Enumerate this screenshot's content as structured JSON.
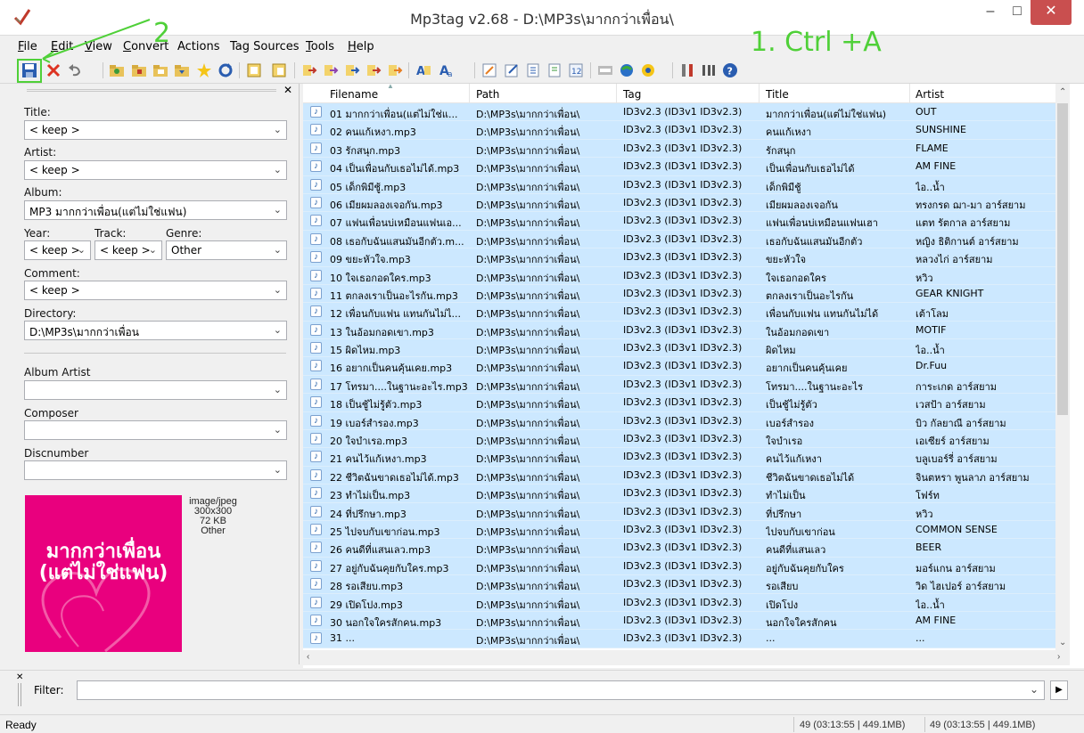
{
  "window": {
    "title": "Mp3tag v2.68  -  D:\\MP3s\\มากกว่าเพื่อน\\",
    "min": "–",
    "max": "□",
    "close": "✕"
  },
  "menu": [
    {
      "label": "File",
      "u": "F",
      "rest": "ile"
    },
    {
      "label": "Edit",
      "u": "E",
      "rest": "dit"
    },
    {
      "label": "View",
      "u": "V",
      "rest": "iew"
    },
    {
      "label": "Convert",
      "u": "C",
      "rest": "onvert"
    },
    {
      "label": "Actions",
      "u": "",
      "rest": "Actions"
    },
    {
      "label": "Tag Sources",
      "u": "",
      "rest": "Tag Sources"
    },
    {
      "label": "Tools",
      "u": "T",
      "rest": "ools"
    },
    {
      "label": "Help",
      "u": "H",
      "rest": "elp"
    }
  ],
  "toolbar_icons": [
    "save-icon",
    "remove-tag-icon",
    "undo-icon",
    "open-folder-icon",
    "add-folder-icon",
    "playlist-folder-icon",
    "folder-icon",
    "favorite-star-icon",
    "refresh-icon",
    "extended-tags-icon",
    "copy-tag-icon",
    "tag-filename-icon",
    "filename-tag-icon",
    "text-file-icon",
    "tag-tag-icon",
    "filename-filename-icon",
    "autonumber-icon",
    "case-convert-icon",
    "format-value-icon",
    "edit-icon",
    "export-icon",
    "playlist-icon",
    "web-source-icon",
    "freedb-icon",
    "tools-icon",
    "options-icon",
    "help-icon"
  ],
  "colors": {
    "row_selected": "#cce8ff",
    "annotation": "#4fd038",
    "cover": "#e9007e",
    "close": "#c94f4f"
  },
  "left_panel": {
    "title_label": "Title:",
    "title_value": "< keep >",
    "artist_label": "Artist:",
    "artist_value": "< keep >",
    "album_label": "Album:",
    "album_value": "MP3 มากกว่าเพื่อน(แต่ไม่ใช่แฟน)",
    "year_label": "Year:",
    "year_value": "< keep >",
    "track_label": "Track:",
    "track_value": "< keep >",
    "genre_label": "Genre:",
    "genre_value": "Other",
    "comment_label": "Comment:",
    "comment_value": "< keep >",
    "directory_label": "Directory:",
    "directory_value": "D:\\MP3s\\มากกว่าเพื่อน",
    "album_artist_label": "Album Artist",
    "composer_label": "Composer",
    "discnumber_label": "Discnumber",
    "cover_text_line1": "มากกว่าเพื่อน",
    "cover_text_line2": "(แต่ไม่ใช่แฟน)",
    "cover_mime": "image/jpeg",
    "cover_dims": "300x300",
    "cover_size": "72 KB",
    "cover_type": "Other"
  },
  "list": {
    "columns": [
      "Filename",
      "Path",
      "Tag",
      "Title",
      "Artist"
    ],
    "rows": [
      {
        "filename": "01 มากกว่าเพื่อน(แต่ไม่ใช่แ...",
        "path": "D:\\MP3s\\มากกว่าเพื่อน\\",
        "tag": "ID3v2.3 (ID3v1 ID3v2.3)",
        "title": "มากกว่าเพื่อน(แต่ไม่ใช่แฟน)",
        "artist": "OUT"
      },
      {
        "filename": "02 คนแก้เหงา.mp3",
        "path": "D:\\MP3s\\มากกว่าเพื่อน\\",
        "tag": "ID3v2.3 (ID3v1 ID3v2.3)",
        "title": "คนแก้เหงา",
        "artist": "SUNSHINE"
      },
      {
        "filename": "03 รักสนุก.mp3",
        "path": "D:\\MP3s\\มากกว่าเพื่อน\\",
        "tag": "ID3v2.3 (ID3v1 ID3v2.3)",
        "title": "รักสนุก",
        "artist": "FLAME"
      },
      {
        "filename": "04 เป็นเพื่อนกับเธอไม่ได้.mp3",
        "path": "D:\\MP3s\\มากกว่าเพื่อน\\",
        "tag": "ID3v2.3 (ID3v1 ID3v2.3)",
        "title": "เป็นเพื่อนกับเธอไม่ได้",
        "artist": "AM FINE"
      },
      {
        "filename": "05 เด็กพิมีชู้.mp3",
        "path": "D:\\MP3s\\มากกว่าเพื่อน\\",
        "tag": "ID3v2.3 (ID3v1 ID3v2.3)",
        "title": "เด็กพิมีชู้",
        "artist": "ไอ..น้ำ"
      },
      {
        "filename": "06 เมียผมลองเจอกัน.mp3",
        "path": "D:\\MP3s\\มากกว่าเพื่อน\\",
        "tag": "ID3v2.3 (ID3v1 ID3v2.3)",
        "title": "เมียผมลองเจอกัน",
        "artist": "ทรงกรด ฌา-มา อาร์สยาม"
      },
      {
        "filename": "07 แฟนเพื่อนบ่เหมือนแฟนเอ...",
        "path": "D:\\MP3s\\มากกว่าเพื่อน\\",
        "tag": "ID3v2.3 (ID3v1 ID3v2.3)",
        "title": "แฟนเพื่อนบ่เหมือนแฟนเฮา",
        "artist": "แตท รัตกาล อาร์สยาม"
      },
      {
        "filename": "08 เธอกับฉันแสนมันอีกตัว.m...",
        "path": "D:\\MP3s\\มากกว่าเพื่อน\\",
        "tag": "ID3v2.3 (ID3v1 ID3v2.3)",
        "title": "เธอกับฉันแสนมันอีกตัว",
        "artist": "หญิง ธิติกานต์ อาร์สยาม"
      },
      {
        "filename": "09 ขยะหัวใจ.mp3",
        "path": "D:\\MP3s\\มากกว่าเพื่อน\\",
        "tag": "ID3v2.3 (ID3v1 ID3v2.3)",
        "title": "ขยะหัวใจ",
        "artist": "หลวงไก่ อาร์สยาม"
      },
      {
        "filename": "10 ใจเธอกอดใคร.mp3",
        "path": "D:\\MP3s\\มากกว่าเพื่อน\\",
        "tag": "ID3v2.3 (ID3v1 ID3v2.3)",
        "title": "ใจเธอกอดใคร",
        "artist": "หวิว"
      },
      {
        "filename": "11 ตกลงเราเป็นอะไรกัน.mp3",
        "path": "D:\\MP3s\\มากกว่าเพื่อน\\",
        "tag": "ID3v2.3 (ID3v1 ID3v2.3)",
        "title": "ตกลงเราเป็นอะไรกัน",
        "artist": "GEAR KNIGHT"
      },
      {
        "filename": "12 เพื่อนกับแฟน แทนกันไม่ไ...",
        "path": "D:\\MP3s\\มากกว่าเพื่อน\\",
        "tag": "ID3v2.3 (ID3v1 ID3v2.3)",
        "title": "เพื่อนกับแฟน แทนกันไม่ได้",
        "artist": "เต้าโลม"
      },
      {
        "filename": "13 ในอ้อมกอดเขา.mp3",
        "path": "D:\\MP3s\\มากกว่าเพื่อน\\",
        "tag": "ID3v2.3 (ID3v1 ID3v2.3)",
        "title": "ในอ้อมกอดเขา",
        "artist": "MOTIF"
      },
      {
        "filename": "15 ผิดไหม.mp3",
        "path": "D:\\MP3s\\มากกว่าเพื่อน\\",
        "tag": "ID3v2.3 (ID3v1 ID3v2.3)",
        "title": "ผิดไหม",
        "artist": "ไอ..น้ำ"
      },
      {
        "filename": "16 อยากเป็นคนคุ้นเคย.mp3",
        "path": "D:\\MP3s\\มากกว่าเพื่อน\\",
        "tag": "ID3v2.3 (ID3v1 ID3v2.3)",
        "title": "อยากเป็นคนคุ้นเคย",
        "artist": "Dr.Fuu"
      },
      {
        "filename": "17 โทรมา....ในฐานะอะไร.mp3",
        "path": "D:\\MP3s\\มากกว่าเพื่อน\\",
        "tag": "ID3v2.3 (ID3v1 ID3v2.3)",
        "title": "โทรมา....ในฐานะอะไร",
        "artist": "การะเกด อาร์สยาม"
      },
      {
        "filename": "18 เป็นชู้ไม่รู้ตัว.mp3",
        "path": "D:\\MP3s\\มากกว่าเพื่อน\\",
        "tag": "ID3v2.3 (ID3v1 ID3v2.3)",
        "title": "เป็นชู้ไม่รู้ตัว",
        "artist": "เวสป้า อาร์สยาม"
      },
      {
        "filename": "19 เบอร์สำรอง.mp3",
        "path": "D:\\MP3s\\มากกว่าเพื่อน\\",
        "tag": "ID3v2.3 (ID3v1 ID3v2.3)",
        "title": "เบอร์สำรอง",
        "artist": "บิว กัลยาณี อาร์สยาม"
      },
      {
        "filename": "20 ใจบำเรอ.mp3",
        "path": "D:\\MP3s\\มากกว่าเพื่อน\\",
        "tag": "ID3v2.3 (ID3v1 ID3v2.3)",
        "title": "ใจบำเรอ",
        "artist": "เอเซียร์ อาร์สยาม"
      },
      {
        "filename": "21 คนไว้แก้เหงา.mp3",
        "path": "D:\\MP3s\\มากกว่าเพื่อน\\",
        "tag": "ID3v2.3 (ID3v1 ID3v2.3)",
        "title": "คนไว้แก้เหงา",
        "artist": "บลูเบอร์รี่ อาร์สยาม"
      },
      {
        "filename": "22 ชีวิตฉันขาดเธอไม่ได้.mp3",
        "path": "D:\\MP3s\\มากกว่าเพื่อน\\",
        "tag": "ID3v2.3 (ID3v1 ID3v2.3)",
        "title": "ชีวิตฉันขาดเธอไม่ได้",
        "artist": "จินตหรา พูนลาภ อาร์สยาม"
      },
      {
        "filename": "23 ทำไม่เป็น.mp3",
        "path": "D:\\MP3s\\มากกว่าเพื่อน\\",
        "tag": "ID3v2.3 (ID3v1 ID3v2.3)",
        "title": "ทำไม่เป็น",
        "artist": "โฟร์ท"
      },
      {
        "filename": "24 ที่ปรึกษา.mp3",
        "path": "D:\\MP3s\\มากกว่าเพื่อน\\",
        "tag": "ID3v2.3 (ID3v1 ID3v2.3)",
        "title": "ที่ปรึกษา",
        "artist": "หวิว"
      },
      {
        "filename": "25 ไปจบกับเขาก่อน.mp3",
        "path": "D:\\MP3s\\มากกว่าเพื่อน\\",
        "tag": "ID3v2.3 (ID3v1 ID3v2.3)",
        "title": "ไปจบกับเขาก่อน",
        "artist": "COMMON SENSE"
      },
      {
        "filename": "26 คนดีที่แสนเลว.mp3",
        "path": "D:\\MP3s\\มากกว่าเพื่อน\\",
        "tag": "ID3v2.3 (ID3v1 ID3v2.3)",
        "title": "คนดีที่แสนเลว",
        "artist": "BEER"
      },
      {
        "filename": "27 อยู่กับฉันคุยกับใคร.mp3",
        "path": "D:\\MP3s\\มากกว่าเพื่อน\\",
        "tag": "ID3v2.3 (ID3v1 ID3v2.3)",
        "title": "อยู่กับฉันคุยกับใคร",
        "artist": "มอร์แกน อาร์สยาม"
      },
      {
        "filename": "28 รอเสียบ.mp3",
        "path": "D:\\MP3s\\มากกว่าเพื่อน\\",
        "tag": "ID3v2.3 (ID3v1 ID3v2.3)",
        "title": "รอเสียบ",
        "artist": "วิด ไฮเปอร์ อาร์สยาม"
      },
      {
        "filename": "29 เปิดโปง.mp3",
        "path": "D:\\MP3s\\มากกว่าเพื่อน\\",
        "tag": "ID3v2.3 (ID3v1 ID3v2.3)",
        "title": "เปิดโปง",
        "artist": "ไอ..น้ำ"
      },
      {
        "filename": "30 นอกใจใครสักคน.mp3",
        "path": "D:\\MP3s\\มากกว่าเพื่อน\\",
        "tag": "ID3v2.3 (ID3v1 ID3v2.3)",
        "title": "นอกใจใครสักคน",
        "artist": "AM FINE"
      },
      {
        "filename": "31 ...",
        "path": "D:\\MP3s\\มากกว่าเพื่อน\\",
        "tag": "ID3v2.3 (ID3v1 ID3v2.3)",
        "title": "...",
        "artist": "..."
      }
    ]
  },
  "filter": {
    "label": "Filter:",
    "value": ""
  },
  "status": {
    "ready": "Ready",
    "left": "49 (03:13:55 | 449.1MB)",
    "right": "49 (03:13:55 | 449.1MB)"
  },
  "annotations": {
    "step1": "1. Ctrl +A",
    "step2": "2"
  }
}
